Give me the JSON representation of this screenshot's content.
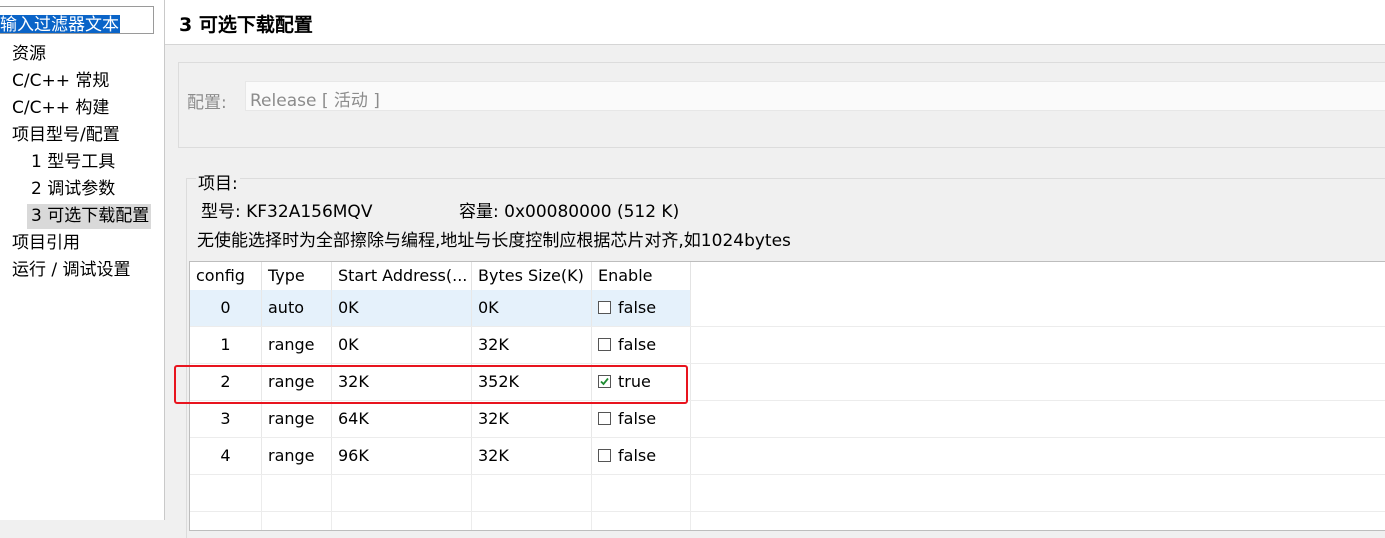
{
  "tree": {
    "filter_text": "输入过滤器文本",
    "items": [
      {
        "label": "资源"
      },
      {
        "label": "C/C++ 常规"
      },
      {
        "label": "C/C++ 构建"
      },
      {
        "label": "项目型号/配置"
      },
      {
        "label": "1 型号工具"
      },
      {
        "label": "2 调试参数"
      },
      {
        "label": "3 可选下载配置"
      },
      {
        "label": "项目引用"
      },
      {
        "label": "运行 / 调试设置"
      }
    ],
    "selected_index": 6
  },
  "header": {
    "title": "3 可选下载配置"
  },
  "config": {
    "label": "配置:",
    "value": "Release  [ 活动 ]"
  },
  "project": {
    "legend": "项目:",
    "model": "型号: KF32A156MQV",
    "capacity": "容量: 0x00080000 (512 K)",
    "hint": "无使能选择时为全部擦除与编程,地址与长度控制应根据芯片对齐,如1024bytes"
  },
  "table": {
    "headers": [
      "config",
      "Type",
      "Start Address(...",
      "Bytes Size(K)",
      "Enable"
    ],
    "rows": [
      {
        "config": "0",
        "type": "auto",
        "start": "0K",
        "size": "0K",
        "enable": "false",
        "checked": false
      },
      {
        "config": "1",
        "type": "range",
        "start": "0K",
        "size": "32K",
        "enable": "false",
        "checked": false
      },
      {
        "config": "2",
        "type": "range",
        "start": "32K",
        "size": "352K",
        "enable": "true",
        "checked": true
      },
      {
        "config": "3",
        "type": "range",
        "start": "64K",
        "size": "32K",
        "enable": "false",
        "checked": false
      },
      {
        "config": "4",
        "type": "range",
        "start": "96K",
        "size": "32K",
        "enable": "false",
        "checked": false
      }
    ],
    "highlighted_row": 0
  },
  "colors": {
    "selection": "#0a64c8",
    "row_highlight": "#e5f1fb",
    "annotation_box": "#e8141e",
    "check_mark": "#1e8c32"
  }
}
